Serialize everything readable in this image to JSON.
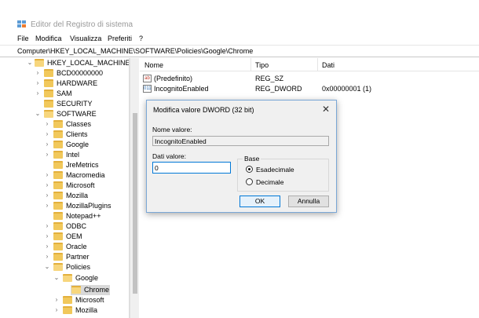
{
  "window": {
    "title": "Editor del Registro di sistema"
  },
  "menu": [
    "File",
    "Modifica",
    "Visualizza",
    "Preferiti",
    "?"
  ],
  "address": "Computer\\HKEY_LOCAL_MACHINE\\SOFTWARE\\Policies\\Google\\Chrome",
  "tree": [
    {
      "label": "HKEY_LOCAL_MACHINE",
      "twisty": "⌄",
      "open": true
    },
    {
      "label": "BCD00000000",
      "twisty": "›",
      "open": false
    },
    {
      "label": "HARDWARE",
      "twisty": "›",
      "open": false
    },
    {
      "label": "SAM",
      "twisty": "›",
      "open": false
    },
    {
      "label": "SECURITY",
      "twisty": "",
      "open": false
    },
    {
      "label": "SOFTWARE",
      "twisty": "⌄",
      "open": true
    },
    {
      "label": "Classes",
      "twisty": "›",
      "open": false
    },
    {
      "label": "Clients",
      "twisty": "›",
      "open": false
    },
    {
      "label": "Google",
      "twisty": "›",
      "open": false
    },
    {
      "label": "Intel",
      "twisty": "›",
      "open": false
    },
    {
      "label": "JreMetrics",
      "twisty": "",
      "open": false
    },
    {
      "label": "Macromedia",
      "twisty": "›",
      "open": false
    },
    {
      "label": "Microsoft",
      "twisty": "›",
      "open": false
    },
    {
      "label": "Mozilla",
      "twisty": "›",
      "open": false
    },
    {
      "label": "MozillaPlugins",
      "twisty": "›",
      "open": false
    },
    {
      "label": "Notepad++",
      "twisty": "",
      "open": false
    },
    {
      "label": "ODBC",
      "twisty": "›",
      "open": false
    },
    {
      "label": "OEM",
      "twisty": "›",
      "open": false
    },
    {
      "label": "Oracle",
      "twisty": "›",
      "open": false
    },
    {
      "label": "Partner",
      "twisty": "›",
      "open": false
    },
    {
      "label": "Policies",
      "twisty": "⌄",
      "open": true
    },
    {
      "label": "Google",
      "twisty": "⌄",
      "open": true
    },
    {
      "label": "Chrome",
      "twisty": "",
      "open": true,
      "selected": true
    },
    {
      "label": "Microsoft",
      "twisty": "›",
      "open": false
    },
    {
      "label": "Mozilla",
      "twisty": "›",
      "open": false
    }
  ],
  "list": {
    "headers": [
      "Nome",
      "Tipo",
      "Dati"
    ],
    "rows": [
      {
        "icon": "ab",
        "name": "(Predefinito)",
        "type": "REG_SZ",
        "data": ""
      },
      {
        "icon": "011",
        "name": "IncognitoEnabled",
        "type": "REG_DWORD",
        "data": "0x00000001 (1)"
      }
    ]
  },
  "dialog": {
    "title": "Modifica valore DWORD (32 bit)",
    "close": "✕",
    "name_label": "Nome valore:",
    "name_value": "IncognitoEnabled",
    "data_label": "Dati valore:",
    "data_value": "0",
    "base_label": "Base",
    "radio_hex": "Esadecimale",
    "radio_dec": "Decimale",
    "ok": "OK",
    "cancel": "Annulla"
  }
}
